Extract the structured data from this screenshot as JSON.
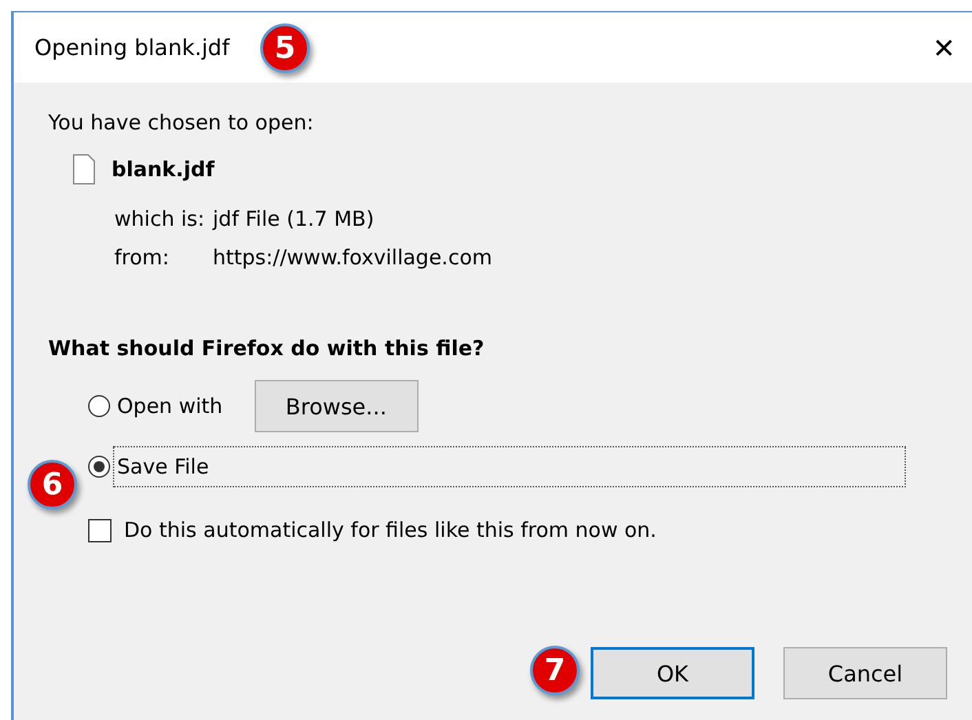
{
  "window": {
    "title": "Opening blank.jdf",
    "close": "✕"
  },
  "intro": "You have chosen to open:",
  "file": {
    "name": "blank.jdf",
    "type_label": "which is:",
    "type": "jdf File (1.7 MB)",
    "from_label": "from:",
    "from": "https://www.foxvillage.com"
  },
  "question": "What should Firefox do with this file?",
  "options": [
    {
      "label": "Open with",
      "selected": false,
      "focused": false
    },
    {
      "label": "Save File",
      "selected": true,
      "focused": true
    }
  ],
  "browse_button": "Browse...",
  "auto": {
    "label": "Do this automatically for files like this from now on.",
    "checked": false
  },
  "buttons": [
    {
      "label": "OK",
      "default": true
    },
    {
      "label": "Cancel",
      "default": false
    }
  ],
  "callouts": [
    "5",
    "6",
    "7"
  ]
}
